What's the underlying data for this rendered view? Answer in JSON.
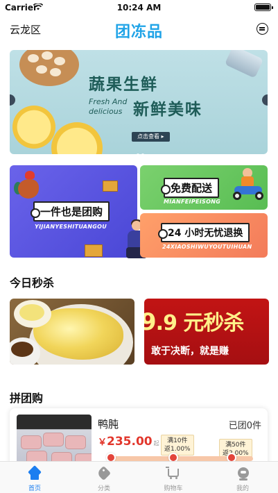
{
  "status_bar": {
    "carrier": "Carrier",
    "time": "10:24 AM",
    "icons": [
      "wifi-icon",
      "battery-icon"
    ]
  },
  "header": {
    "location": "云龙区",
    "logo": "团冻品",
    "chat_icon": "chat-bubble-icon"
  },
  "banner": {
    "title_line1": "蔬果生鲜",
    "title_line2": "新鲜美味",
    "en_line1": "Fresh And",
    "en_line2": "delicious",
    "button": "点击查看 ▸"
  },
  "promos": {
    "group": {
      "title": "一件也是团购",
      "pinyin": "YIJIANYESHITUANGOU"
    },
    "delivery": {
      "title": "免费配送",
      "pinyin": "MIANFEIPEISONG"
    },
    "refund": {
      "title": "24 小时无忧退换",
      "pinyin": "24XIAOSHIWUYOUTUIHUAN"
    }
  },
  "flash_sale": {
    "title": "今日秒杀",
    "promo_big_prefix": "9",
    "promo_big_text": ".9 元秒杀",
    "promo_sub": "敢于决断，就是赚"
  },
  "group_buy": {
    "title": "拼团购",
    "product": {
      "name": "鸭肫",
      "joined": "已团0件",
      "currency": "￥",
      "price": "235.00",
      "unit": "起",
      "progress": 0.0,
      "tiers": [
        {
          "line1": "满10件",
          "line2": "返1.00%"
        },
        {
          "line1": "满50件",
          "line2": "返2.00%"
        }
      ]
    }
  },
  "tabbar": {
    "items": [
      {
        "label": "首页",
        "icon": "home-icon",
        "active": true
      },
      {
        "label": "分类",
        "icon": "tag-icon",
        "active": false
      },
      {
        "label": "购物车",
        "icon": "cart-icon",
        "active": false
      },
      {
        "label": "我的",
        "icon": "user-icon",
        "active": false
      }
    ]
  },
  "colors": {
    "accent": "#1c7ef0",
    "price": "#e2372c",
    "logo": "#1fa3e7"
  }
}
